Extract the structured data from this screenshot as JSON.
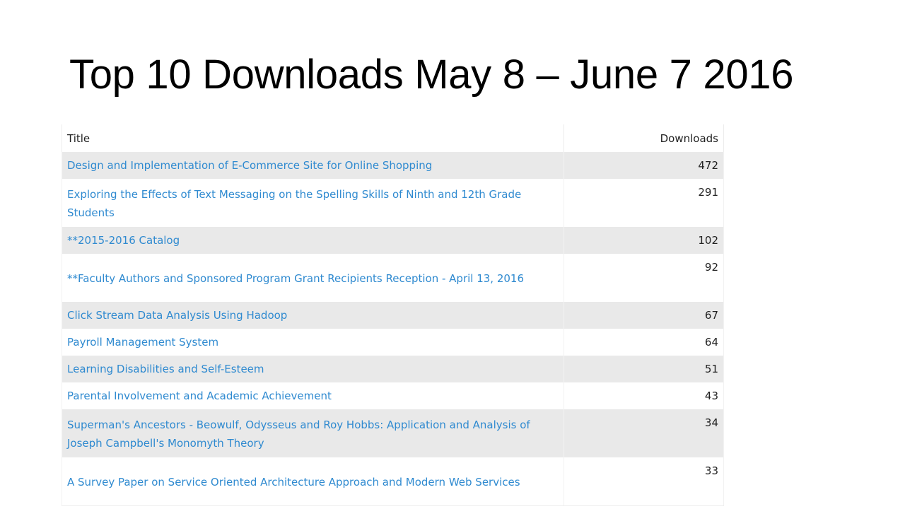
{
  "slide": {
    "title": "Top 10 Downloads May 8 – June 7 2016"
  },
  "table": {
    "headers": {
      "title": "Title",
      "downloads": "Downloads"
    },
    "rows": [
      {
        "title": "Design and Implementation of E-Commerce Site for Online Shopping",
        "downloads": "472"
      },
      {
        "title": "Exploring the Effects of Text Messaging on the Spelling Skills of Ninth and 12th Grade Students",
        "downloads": "291"
      },
      {
        "title": "**2015-2016 Catalog",
        "downloads": "102"
      },
      {
        "title": "**Faculty Authors and Sponsored Program Grant Recipients Reception - April 13, 2016",
        "downloads": "92"
      },
      {
        "title": "Click Stream Data Analysis Using Hadoop",
        "downloads": "67"
      },
      {
        "title": "Payroll Management System",
        "downloads": "64"
      },
      {
        "title": "Learning Disabilities and Self-Esteem",
        "downloads": "51"
      },
      {
        "title": "Parental Involvement and Academic Achievement",
        "downloads": "43"
      },
      {
        "title": "Superman's Ancestors - Beowulf, Odysseus and Roy Hobbs: Application and Analysis of Joseph Campbell's Monomyth Theory",
        "downloads": "34"
      },
      {
        "title": "A Survey Paper on Service Oriented Architecture Approach and Modern Web Services",
        "downloads": "33"
      }
    ]
  },
  "colors": {
    "link": "#2f8ad0",
    "stripe": "#e9e9e9"
  }
}
